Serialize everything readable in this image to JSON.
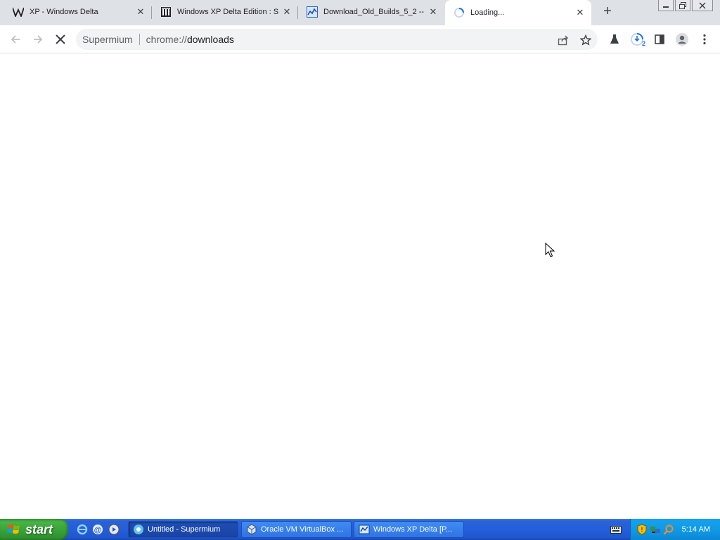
{
  "browser": {
    "tabs": [
      {
        "title": "XP - Windows Delta",
        "icon": "wikipedia-w-icon"
      },
      {
        "title": "Windows XP Delta Edition : S\\",
        "icon": "archive-columns-icon"
      },
      {
        "title": "Download_Old_Builds_5_2 --",
        "icon": "chart-favicon-icon"
      },
      {
        "title": "Loading...",
        "icon": "loading-spinner-icon"
      }
    ],
    "omnibox": {
      "chip": "Supermium",
      "scheme": "chrome://",
      "host": "downloads"
    },
    "download_badge": "2"
  },
  "taskbar": {
    "start_label": "start",
    "tasks": [
      {
        "label": "Untitled - Supermium",
        "icon": "supermium-icon"
      },
      {
        "label": "Oracle VM VirtualBox ...",
        "icon": "virtualbox-icon"
      },
      {
        "label": "Windows XP Delta [P...",
        "icon": "xp-window-icon"
      }
    ],
    "clock": "5:14 AM"
  },
  "colors": {
    "tab_strip": "#dee1e6",
    "omnibox_bg": "#f1f3f4",
    "taskbar_blue": "#245edb",
    "start_green": "#3c9c3c",
    "tray_blue": "#109ae6"
  }
}
